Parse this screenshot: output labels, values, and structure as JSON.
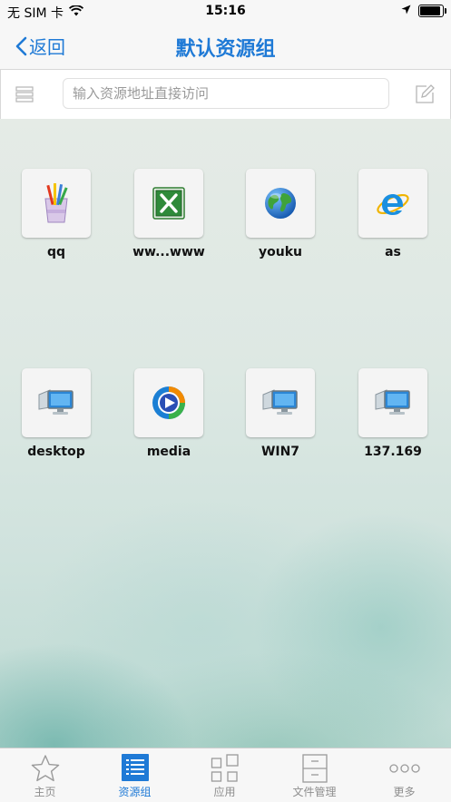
{
  "status": {
    "carrier": "无 SIM 卡",
    "time": "15:16"
  },
  "nav": {
    "back_label": "返回",
    "title": "默认资源组"
  },
  "search": {
    "placeholder": "输入资源地址直接访问"
  },
  "resources": [
    {
      "label": "qq",
      "icon": "paint-brushes-icon"
    },
    {
      "label": "ww...www",
      "icon": "excel-icon"
    },
    {
      "label": "youku",
      "icon": "globe-icon"
    },
    {
      "label": "as",
      "icon": "internet-explorer-icon"
    },
    {
      "label": "desktop",
      "icon": "remote-desktop-icon"
    },
    {
      "label": "media",
      "icon": "media-player-icon"
    },
    {
      "label": "WIN7",
      "icon": "remote-desktop-icon"
    },
    {
      "label": "137.169",
      "icon": "remote-desktop-icon"
    }
  ],
  "tabs": [
    {
      "label": "主页",
      "icon": "star-icon"
    },
    {
      "label": "资源组",
      "icon": "list-icon",
      "active": true
    },
    {
      "label": "应用",
      "icon": "grid-icon"
    },
    {
      "label": "文件管理",
      "icon": "cabinet-icon"
    },
    {
      "label": "更多",
      "icon": "more-icon"
    }
  ],
  "colors": {
    "accent": "#1f7ad6",
    "inactive_tab": "#8e8e8e"
  }
}
